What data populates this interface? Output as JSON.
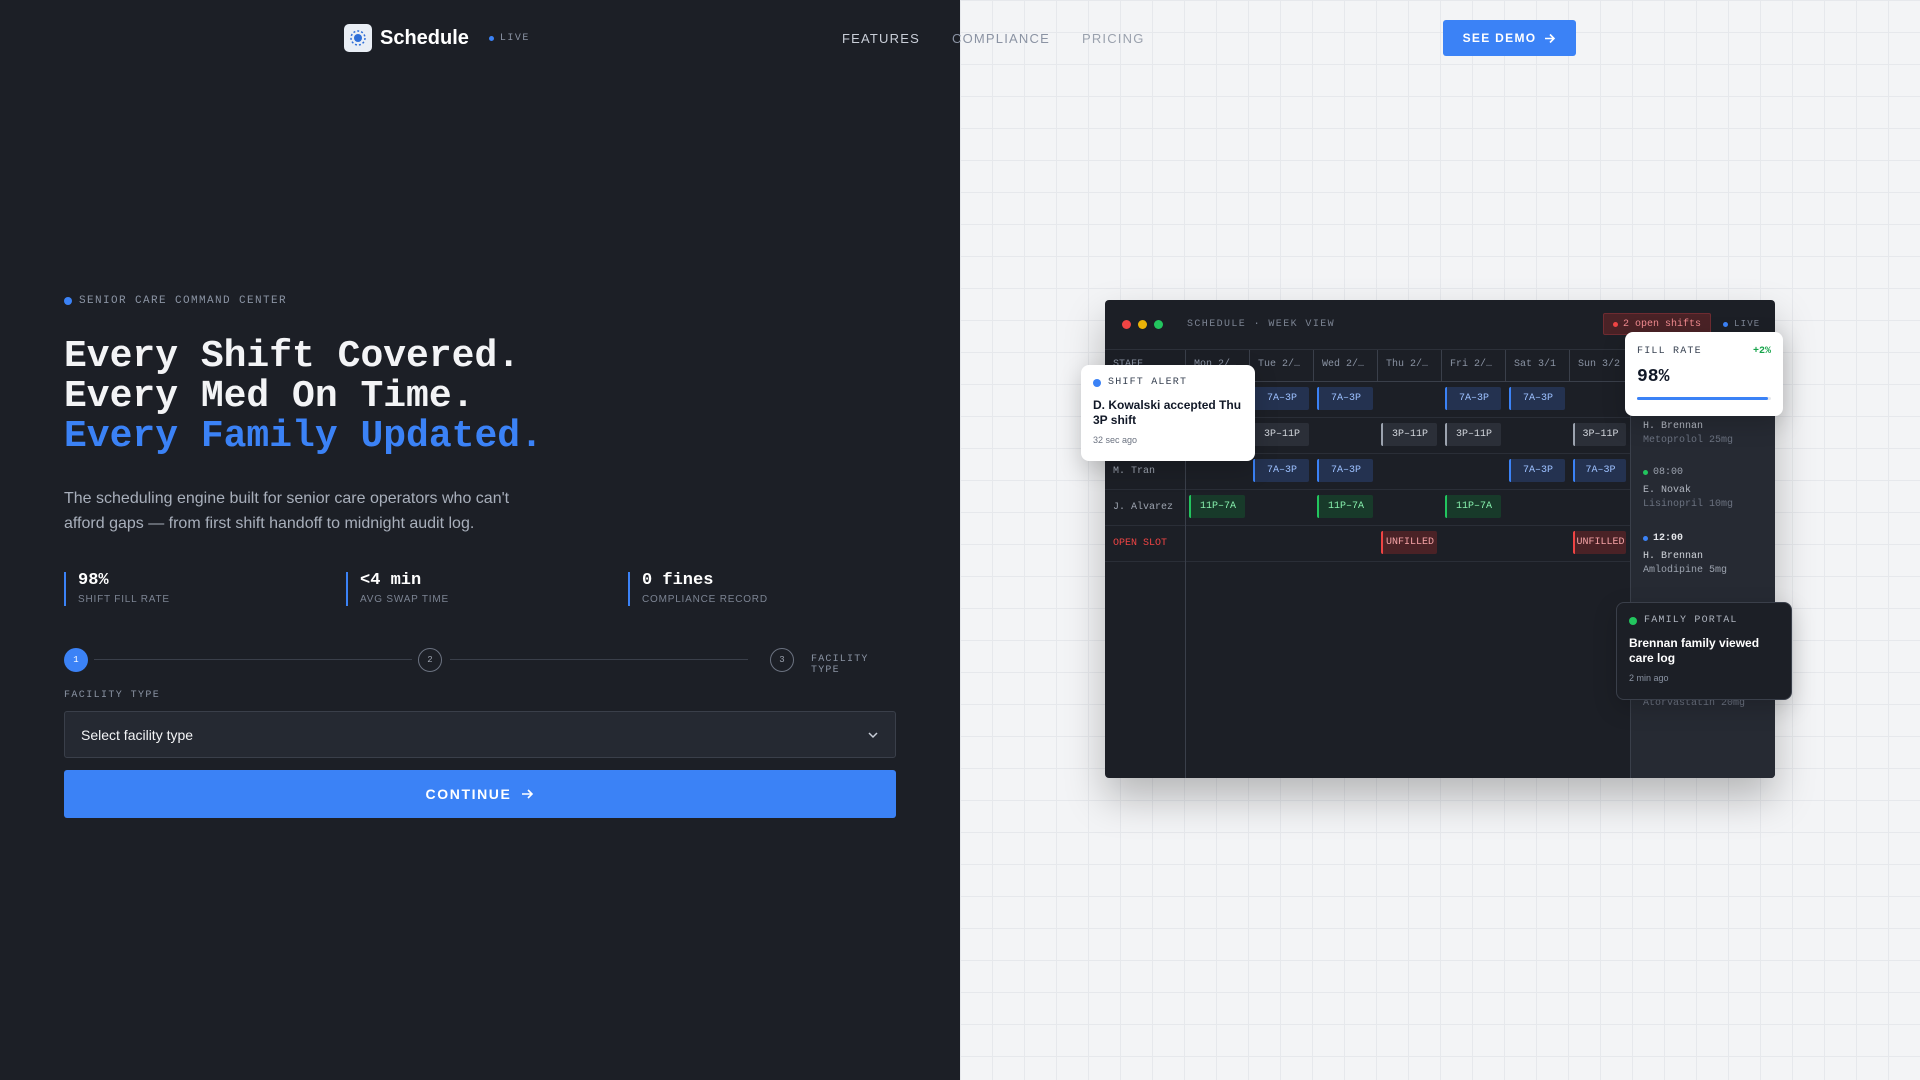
{
  "brand": {
    "name": "Schedule",
    "live": "LIVE"
  },
  "nav": {
    "features": "FEATURES",
    "compliance": "COMPLIANCE",
    "pricing": "PRICING"
  },
  "cta": {
    "demo": "SEE DEMO",
    "continue": "CONTINUE"
  },
  "hero": {
    "eyebrow": "SENIOR CARE COMMAND CENTER",
    "line1": "Every Shift Covered.",
    "line2": "Every Med On Time.",
    "line3": "Every Family Updated.",
    "subtitle": "The scheduling engine built for senior care operators who can't afford gaps — from first shift handoff to midnight audit log."
  },
  "stats": [
    {
      "value": "98%",
      "label": "SHIFT FILL RATE"
    },
    {
      "value": "<4 min",
      "label": "AVG SWAP TIME"
    },
    {
      "value": "0 fines",
      "label": "COMPLIANCE RECORD"
    }
  ],
  "steps": {
    "s1": "1",
    "s2": "2",
    "s3": "3",
    "current_label": "FACILITY TYPE"
  },
  "form": {
    "label": "FACILITY TYPE",
    "select_value": "Select facility type"
  },
  "app": {
    "title": "SCHEDULE · WEEK VIEW",
    "open_shifts": "2 open shifts",
    "live": "LIVE",
    "columns": [
      "STAFF",
      "Mon 2/…",
      "Tue 2/…",
      "Wed 2/…",
      "Thu 2/…",
      "Fri 2/…",
      "Sat 3/1",
      "Sun 3/2"
    ],
    "rows": [
      {
        "name": "",
        "shifts": [
          "",
          "7A–3P",
          "7A–3P",
          "",
          "7A–3P",
          "7A–3P",
          ""
        ]
      },
      {
        "name": "",
        "shifts": [
          "",
          "3P–11P",
          "",
          "3P–11P",
          "3P–11P",
          "",
          "3P–11P"
        ]
      },
      {
        "name": "M. Tran",
        "shifts": [
          "",
          "7A–3P",
          "7A–3P",
          "",
          "",
          "7A–3P",
          "7A–3P"
        ]
      },
      {
        "name": "J. Alvarez",
        "shifts": [
          "11P–7A",
          "",
          "11P–7A",
          "",
          "11P–7A",
          "",
          ""
        ]
      },
      {
        "name": "OPEN SLOT",
        "shifts": [
          "",
          "",
          "",
          "UNFILLED",
          "",
          "",
          "UNFILLED"
        ]
      }
    ],
    "meds": [
      {
        "time": "",
        "name": "H. Brennan",
        "drug": "Metoprolol 25mg"
      },
      {
        "time": "08:00",
        "name": "E. Novak",
        "drug": "Lisinopril 10mg"
      },
      {
        "time": "12:00",
        "name": "H. Brennan",
        "drug": "Amlodipine 5mg"
      },
      {
        "time": "",
        "name": "",
        "drug": "Atorvastatin 20mg"
      }
    ]
  },
  "alert_card": {
    "tag": "SHIFT ALERT",
    "message": "D. Kowalski accepted Thu 3P shift",
    "time": "32 sec ago"
  },
  "fill_card": {
    "label": "FILL RATE",
    "delta": "+2%",
    "value": "98%",
    "progress": 0.98
  },
  "portal_card": {
    "tag": "FAMILY PORTAL",
    "message": "Brennan family viewed care log",
    "time": "2 min ago"
  },
  "colors": {
    "accent": "#3b82f6",
    "danger": "#ef4444",
    "success": "#22c55e",
    "dark_bg": "#1c1f26",
    "light_bg": "#f3f4f6"
  }
}
